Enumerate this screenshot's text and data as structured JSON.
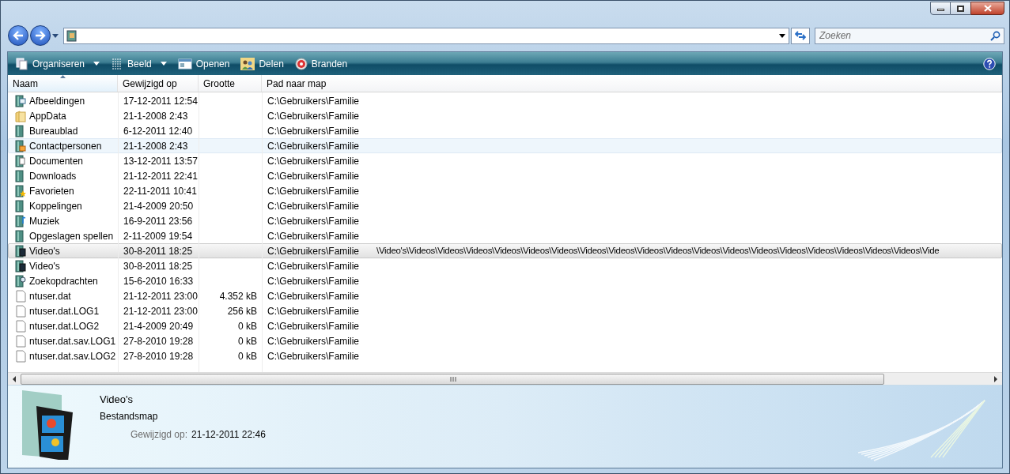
{
  "search": {
    "placeholder": "Zoeken"
  },
  "toolbar": [
    {
      "label": "Organiseren",
      "kind": "organize",
      "dropdown": true
    },
    {
      "label": "Beeld",
      "kind": "view",
      "dropdown": true
    },
    {
      "label": "Openen",
      "kind": "open",
      "dropdown": false
    },
    {
      "label": "Delen",
      "kind": "share",
      "dropdown": false
    },
    {
      "label": "Branden",
      "kind": "burn",
      "dropdown": false
    }
  ],
  "columns": [
    {
      "label": "Naam",
      "sorted": true
    },
    {
      "label": "Gewijzigd op",
      "sorted": false
    },
    {
      "label": "Grootte",
      "sorted": false
    },
    {
      "label": "Pad naar map",
      "sorted": false
    }
  ],
  "rows": [
    {
      "name": "Afbeeldingen",
      "modified": "17-12-2011 12:54",
      "path": "C:\\Gebruikers\\Familie",
      "kind": "pictures",
      "selected": false,
      "hovered": false
    },
    {
      "name": "AppData",
      "modified": "21-1-2008 2:43",
      "path": "C:\\Gebruikers\\Familie",
      "kind": "plain_folder",
      "selected": false,
      "hovered": false
    },
    {
      "name": "Bureaublad",
      "modified": "6-12-2011 12:40",
      "path": "C:\\Gebruikers\\Familie",
      "kind": "folder",
      "selected": false,
      "hovered": false
    },
    {
      "name": "Contactpersonen",
      "modified": "21-1-2008 2:43",
      "path": "C:\\Gebruikers\\Familie",
      "kind": "contacts",
      "selected": false,
      "hovered": true
    },
    {
      "name": "Documenten",
      "modified": "13-12-2011 13:57",
      "path": "C:\\Gebruikers\\Familie",
      "kind": "documents",
      "selected": false,
      "hovered": false
    },
    {
      "name": "Downloads",
      "modified": "21-12-2011 22:41",
      "path": "C:\\Gebruikers\\Familie",
      "kind": "folder",
      "selected": false,
      "hovered": false
    },
    {
      "name": "Favorieten",
      "modified": "22-11-2011 10:41",
      "path": "C:\\Gebruikers\\Familie",
      "kind": "favorites",
      "selected": false,
      "hovered": false
    },
    {
      "name": "Koppelingen",
      "modified": "21-4-2009 20:50",
      "path": "C:\\Gebruikers\\Familie",
      "kind": "folder",
      "selected": false,
      "hovered": false
    },
    {
      "name": "Muziek",
      "modified": "16-9-2011 23:56",
      "path": "C:\\Gebruikers\\Familie",
      "kind": "music",
      "selected": false,
      "hovered": false
    },
    {
      "name": "Opgeslagen spellen",
      "modified": "2-11-2009 19:54",
      "path": "C:\\Gebruikers\\Familie",
      "kind": "folder",
      "selected": false,
      "hovered": false
    },
    {
      "name": "Video's",
      "modified": "30-8-2011 18:25",
      "path": "C:\\Gebruikers\\Familie",
      "path_overflow": "\\Video's\\Videos\\Videos\\Videos\\Videos\\Videos\\Videos\\Videos\\Videos\\Videos\\Videos\\Videos\\Videos\\Videos\\Videos\\Videos\\Videos\\Videos\\Videos\\Vide",
      "kind": "videos",
      "selected": true,
      "hovered": false
    },
    {
      "name": "Video's",
      "modified": "30-8-2011 18:25",
      "path": "C:\\Gebruikers\\Familie",
      "kind": "videos",
      "selected": false,
      "hovered": false
    },
    {
      "name": "Zoekopdrachten",
      "modified": "15-6-2010 16:33",
      "path": "C:\\Gebruikers\\Familie",
      "kind": "searches",
      "selected": false,
      "hovered": false
    },
    {
      "name": "ntuser.dat",
      "modified": "21-12-2011 23:00",
      "size": "4.352 kB",
      "path": "C:\\Gebruikers\\Familie",
      "kind": "file",
      "selected": false,
      "hovered": false
    },
    {
      "name": "ntuser.dat.LOG1",
      "modified": "21-12-2011 23:00",
      "size": "256 kB",
      "path": "C:\\Gebruikers\\Familie",
      "kind": "file",
      "selected": false,
      "hovered": false
    },
    {
      "name": "ntuser.dat.LOG2",
      "modified": "21-4-2009 20:49",
      "size": "0 kB",
      "path": "C:\\Gebruikers\\Familie",
      "kind": "file",
      "selected": false,
      "hovered": false
    },
    {
      "name": "ntuser.dat.sav.LOG1",
      "modified": "27-8-2010 19:28",
      "size": "0 kB",
      "path": "C:\\Gebruikers\\Familie",
      "kind": "file",
      "selected": false,
      "hovered": false
    },
    {
      "name": "ntuser.dat.sav.LOG2",
      "modified": "27-8-2010 19:28",
      "size": "0 kB",
      "path": "C:\\Gebruikers\\Familie",
      "kind": "file",
      "selected": false,
      "hovered": false
    }
  ],
  "details": {
    "title": "Video's",
    "type": "Bestandsmap",
    "properties": [
      {
        "label": "Gewijzigd op:",
        "value": "21-12-2011 22:46"
      }
    ]
  }
}
